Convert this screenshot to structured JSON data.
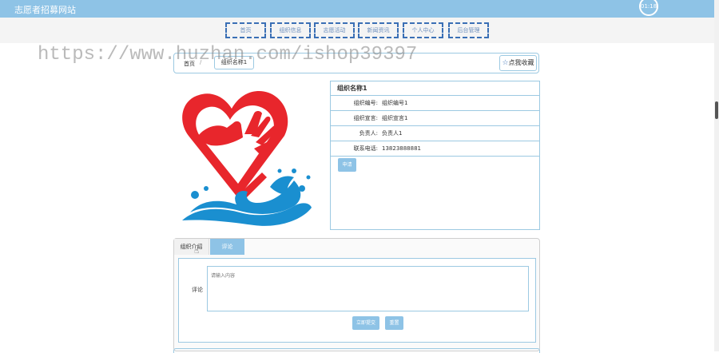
{
  "header": {
    "site_title": "志愿者招募网站",
    "clock": "01:18"
  },
  "nav": {
    "items": [
      {
        "label": "首页"
      },
      {
        "label": "组织信息"
      },
      {
        "label": "志愿活动"
      },
      {
        "label": "新闻资讯"
      },
      {
        "label": "个人中心"
      },
      {
        "label": "后台管理"
      }
    ]
  },
  "watermark": "https://www.huzhan.com/ishop39397",
  "breadcrumb": {
    "home": "首页",
    "separator": "/",
    "current": "组织名称1",
    "favorite": "点我收藏"
  },
  "colors": {
    "accent": "#8ec3e6",
    "nav_border": "#3a6fb5",
    "logo_red": "#e8262c",
    "logo_blue": "#1a8fd0"
  },
  "info": {
    "title": "组织名称1",
    "rows": [
      {
        "label": "组织编号:",
        "value": "组织编号1"
      },
      {
        "label": "组织宣言:",
        "value": "组织宣言1"
      },
      {
        "label": "负责人:",
        "value": "负责人1"
      },
      {
        "label": "联系电话:",
        "value": "13823888881"
      }
    ],
    "apply": "申请"
  },
  "tabs": {
    "intro": "组织介绍",
    "comment": "评论"
  },
  "comment": {
    "label": "评论",
    "placeholder": "请输入内容",
    "submit": "立即提交",
    "reset": "重置"
  }
}
